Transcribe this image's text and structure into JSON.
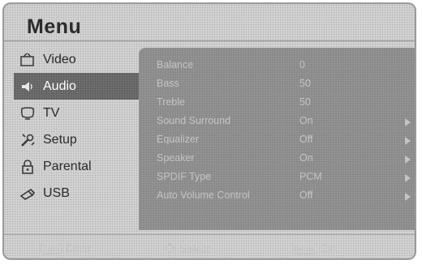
{
  "title": "Menu",
  "menu": [
    {
      "label": "Video",
      "icon": "video-icon"
    },
    {
      "label": "Audio",
      "icon": "audio-icon",
      "active": true
    },
    {
      "label": "TV",
      "icon": "tv-icon"
    },
    {
      "label": "Setup",
      "icon": "setup-icon"
    },
    {
      "label": "Parental",
      "icon": "lock-icon"
    },
    {
      "label": "USB",
      "icon": "usb-icon"
    }
  ],
  "audio_settings": [
    {
      "label": "Balance",
      "value": "0",
      "arrow": false
    },
    {
      "label": "Bass",
      "value": "50",
      "arrow": false
    },
    {
      "label": "Treble",
      "value": "50",
      "arrow": false
    },
    {
      "label": "Sound Surround",
      "value": "On",
      "arrow": true
    },
    {
      "label": "Equalizer",
      "value": "Off",
      "arrow": true
    },
    {
      "label": "Speaker",
      "value": "On",
      "arrow": true
    },
    {
      "label": "SPDIF Type",
      "value": "PCM",
      "arrow": true
    },
    {
      "label": "Auto Volume Control",
      "value": "Off",
      "arrow": true
    }
  ],
  "footer": {
    "enter_key": "Enter",
    "enter_label": "Enter",
    "select_label": "Select",
    "exit_key": "Return",
    "exit_label": "Exit"
  }
}
